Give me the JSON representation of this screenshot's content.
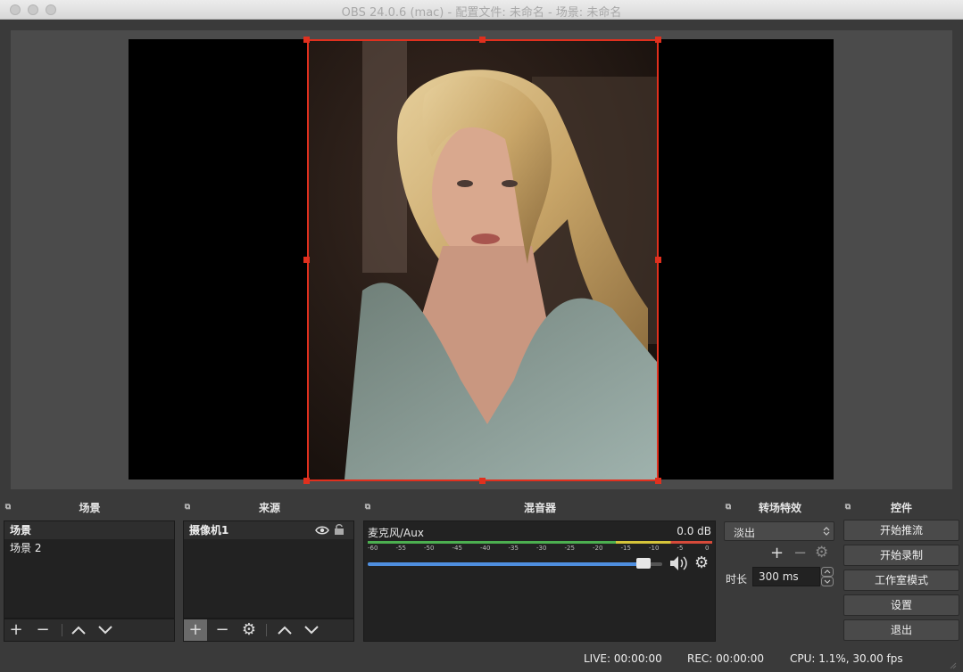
{
  "window": {
    "title": "OBS 24.0.6 (mac) - 配置文件: 未命名 - 场景: 未命名"
  },
  "docks": {
    "scenes": {
      "title": "场景",
      "items": [
        "场景",
        "场景 2"
      ]
    },
    "sources": {
      "title": "来源",
      "items": [
        "摄像机1"
      ]
    },
    "mixer": {
      "title": "混音器",
      "channel_name": "麦克风/Aux",
      "level": "0.0 dB",
      "ticks": [
        "-60",
        "-55",
        "-50",
        "-45",
        "-40",
        "-35",
        "-30",
        "-25",
        "-20",
        "-15",
        "-10",
        "-5",
        "0"
      ],
      "volume_fraction": 0.96
    },
    "transitions": {
      "title": "转场特效",
      "selected": "淡出",
      "duration_label": "时长",
      "duration_value": "300 ms"
    },
    "controls": {
      "title": "控件",
      "buttons": [
        "开始推流",
        "开始录制",
        "工作室模式",
        "设置",
        "退出"
      ]
    }
  },
  "status": {
    "live": "LIVE: 00:00:00",
    "rec": "REC: 00:00:00",
    "cpu": "CPU: 1.1%, 30.00 fps"
  },
  "colors": {
    "selection": "#e0301e",
    "volume_bar": "#4f8fe0"
  }
}
